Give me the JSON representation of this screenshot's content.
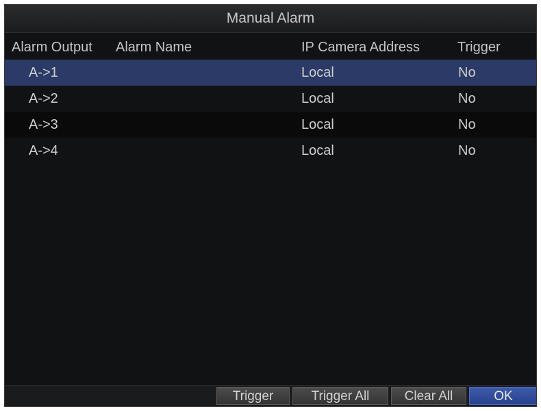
{
  "window": {
    "title": "Manual Alarm"
  },
  "table": {
    "headers": {
      "alarm_output": "Alarm Output",
      "alarm_name": "Alarm Name",
      "ip_camera_address": "IP Camera Address",
      "trigger": "Trigger"
    },
    "rows": [
      {
        "alarm_output": "A->1",
        "ip_camera_address": "Local",
        "trigger": "No",
        "selected": true
      },
      {
        "alarm_output": "A->2",
        "ip_camera_address": "Local",
        "trigger": "No",
        "selected": false
      },
      {
        "alarm_output": "A->3",
        "ip_camera_address": "Local",
        "trigger": "No",
        "selected": false
      },
      {
        "alarm_output": "A->4",
        "ip_camera_address": "Local",
        "trigger": "No",
        "selected": false
      }
    ]
  },
  "buttons": {
    "trigger": "Trigger",
    "trigger_all": "Trigger All",
    "clear_all": "Clear All",
    "ok": "OK"
  },
  "colors": {
    "background": "#111214",
    "selected_row": "#2b3a66",
    "ok_button": "#2a4290"
  }
}
